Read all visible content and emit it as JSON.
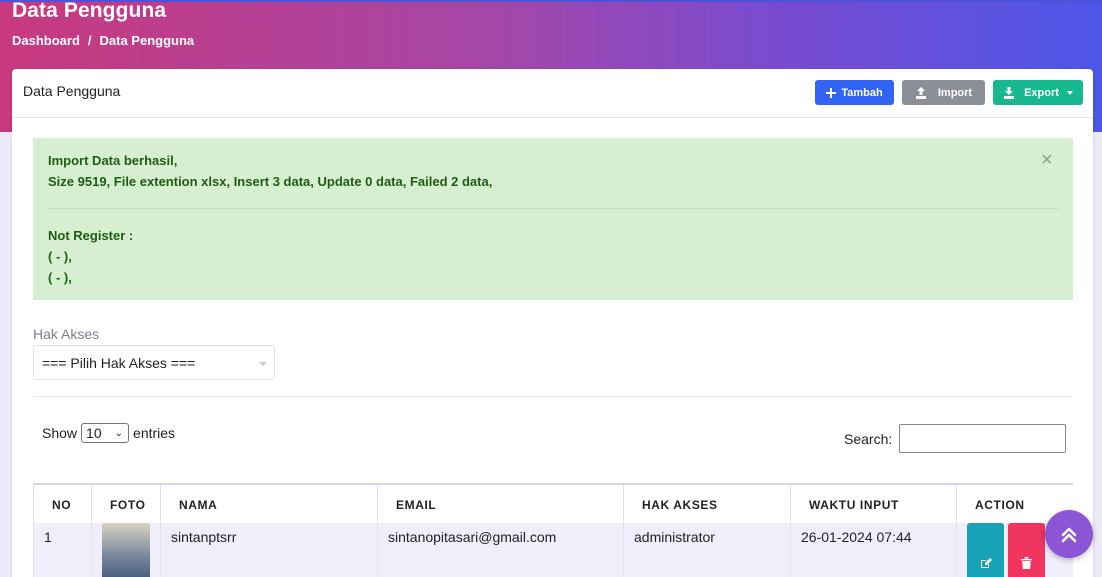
{
  "page": {
    "title": "Data Pengguna"
  },
  "breadcrumb": {
    "home": "Dashboard",
    "separator": "/",
    "current": "Data Pengguna"
  },
  "card": {
    "title": "Data Pengguna",
    "buttons": {
      "tambah": "Tambah",
      "import": "Import",
      "export": "Export"
    }
  },
  "alert": {
    "line1": "Import Data berhasil,",
    "line2": "Size 9519, File extention xlsx, Insert 3 data, Update 0 data, Failed 2 data,",
    "line3": "Not Register :",
    "line4": "( - ),",
    "line5": "( - ),",
    "close": "×"
  },
  "filter": {
    "label": "Hak Akses",
    "selected": "=== Pilih Hak Akses ==="
  },
  "table_controls": {
    "show": "Show",
    "entries_value": "10",
    "entries": "entries",
    "search": "Search:"
  },
  "table": {
    "headers": [
      "NO",
      "FOTO",
      "NAMA",
      "EMAIL",
      "HAK AKSES",
      "WAKTU INPUT",
      "ACTION"
    ],
    "rows": [
      {
        "no": "1",
        "nama": "sintanptsrr",
        "email": "sintanopitasari@gmail.com",
        "hak_akses": "administrator",
        "waktu_input": "26-01-2024 07:44"
      }
    ]
  },
  "colors": {
    "primary": "#3164f4",
    "secondary": "#8a8f98",
    "success": "#17b890",
    "info": "#17a2b8",
    "danger": "#f0355f",
    "alert_bg": "#d6efd0"
  },
  "icons": {
    "tambah": "plus-icon",
    "import": "upload-icon",
    "export": "download-icon",
    "edit": "edit-icon",
    "delete": "trash-icon",
    "scroll": "chevrons-up-icon"
  }
}
